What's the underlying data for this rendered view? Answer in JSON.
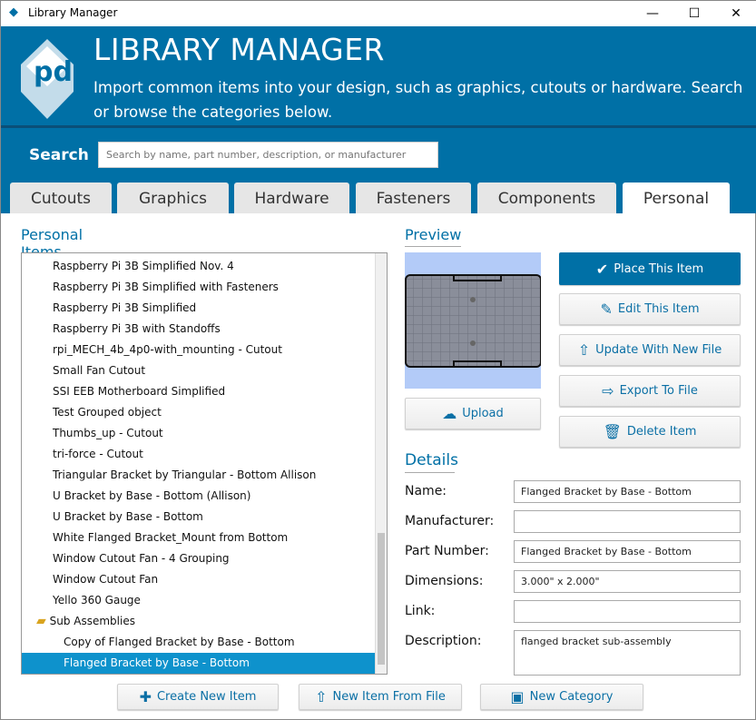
{
  "window": {
    "title": "Library Manager",
    "minimize": "—",
    "maximize": "☐",
    "close": "✕"
  },
  "header": {
    "title": "LIBRARY MANAGER",
    "subtitle": "Import common items into your design, such as graphics, cutouts or hardware. Search or browse the categories below."
  },
  "search": {
    "label": "Search",
    "placeholder": "Search by name, part number, description, or manufacturer"
  },
  "tabs": [
    {
      "label": "Cutouts"
    },
    {
      "label": "Graphics"
    },
    {
      "label": "Hardware"
    },
    {
      "label": "Fasteners"
    },
    {
      "label": "Components"
    },
    {
      "label": "Personal",
      "selected": true
    }
  ],
  "list": {
    "title": "Personal Items",
    "items": [
      "Raspberry Pi 3B Simplified Nov. 4",
      "Raspberry Pi 3B Simplified with Fasteners",
      "Raspberry Pi 3B Simplified",
      "Raspberry Pi 3B with Standoffs",
      "rpi_MECH_4b_4p0-with_mounting - Cutout",
      "Small Fan Cutout",
      "SSI EEB Motherboard Simplified",
      "Test Grouped object",
      "Thumbs_up - Cutout",
      "tri-force - Cutout",
      "Triangular Bracket by Triangular - Bottom Allison",
      "U Bracket by Base - Bottom (Allison)",
      "U Bracket by Base - Bottom",
      "White Flanged Bracket_Mount from Bottom",
      "Window Cutout Fan - 4 Grouping",
      "Window Cutout Fan",
      "Yello 360 Gauge"
    ],
    "folder": "Sub Assemblies",
    "sub_items": [
      "Copy of Flanged Bracket by Base - Bottom",
      "Flanged Bracket by Base - Bottom"
    ],
    "selected": "Flanged Bracket by Base - Bottom"
  },
  "preview": {
    "title": "Preview",
    "upload": "Upload"
  },
  "actions": {
    "place": "Place This Item",
    "edit": "Edit This Item",
    "update": "Update With New File",
    "export": "Export To File",
    "delete": "Delete Item"
  },
  "details": {
    "title": "Details",
    "fields": [
      {
        "label": "Name:",
        "value": "Flanged Bracket by Base - Bottom"
      },
      {
        "label": "Manufacturer:",
        "value": ""
      },
      {
        "label": "Part Number:",
        "value": "Flanged Bracket by Base - Bottom"
      },
      {
        "label": "Dimensions:",
        "value": "3.000\" x 2.000\""
      },
      {
        "label": "Link:",
        "value": ""
      },
      {
        "label": "Description:",
        "value": "flanged bracket sub-assembly"
      }
    ]
  },
  "bottom": {
    "create": "Create New Item",
    "from_file": "New Item From File",
    "category": "New Category"
  },
  "colors": {
    "brand": "#0070a6",
    "selection": "#0e92cc",
    "preview_bg": "#b3cbf8"
  }
}
